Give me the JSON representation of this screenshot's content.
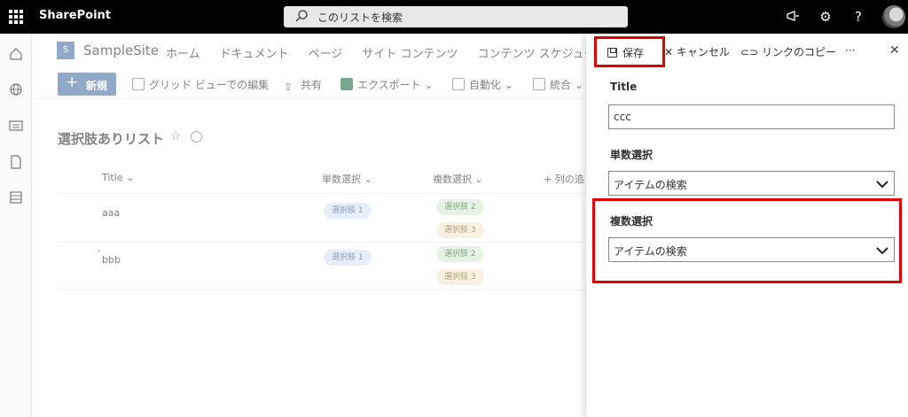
{
  "suite": {
    "brand": "SharePoint",
    "search_placeholder": "このリストを検索"
  },
  "site": {
    "logo_letter": "S",
    "name": "SampleSite",
    "nav": [
      "ホーム",
      "ドキュメント",
      "ページ",
      "サイト コンテンツ",
      "コンテンツ スケジューラ"
    ]
  },
  "commands": {
    "new": "新規",
    "grid": "グリッド ビューでの編集",
    "share": "共有",
    "export": "エクスポート",
    "automate": "自動化",
    "integrate": "統合"
  },
  "list": {
    "title": "選択肢ありリスト",
    "columns": [
      "Title",
      "単数選択",
      "複数選択",
      "列の追"
    ],
    "rows": [
      {
        "title": "aaa",
        "single": "選択肢 1",
        "multi": [
          "選択肢 2",
          "選択肢 3"
        ]
      },
      {
        "title": "bbb",
        "single": "選択肢 1",
        "multi": [
          "選択肢 2",
          "選択肢 3"
        ]
      }
    ]
  },
  "panel": {
    "save": "保存",
    "cancel": "キャンセル",
    "copy_link": "リンクのコピー",
    "more": "···",
    "fields": [
      {
        "label": "Title",
        "value": "ccc"
      },
      {
        "label": "単数選択",
        "value": "アイテムの検索"
      },
      {
        "label": "複数選択",
        "value": "アイテムの検索"
      }
    ]
  },
  "colors": {
    "accent": "#4a6fa5",
    "highlight": "#e00000"
  }
}
